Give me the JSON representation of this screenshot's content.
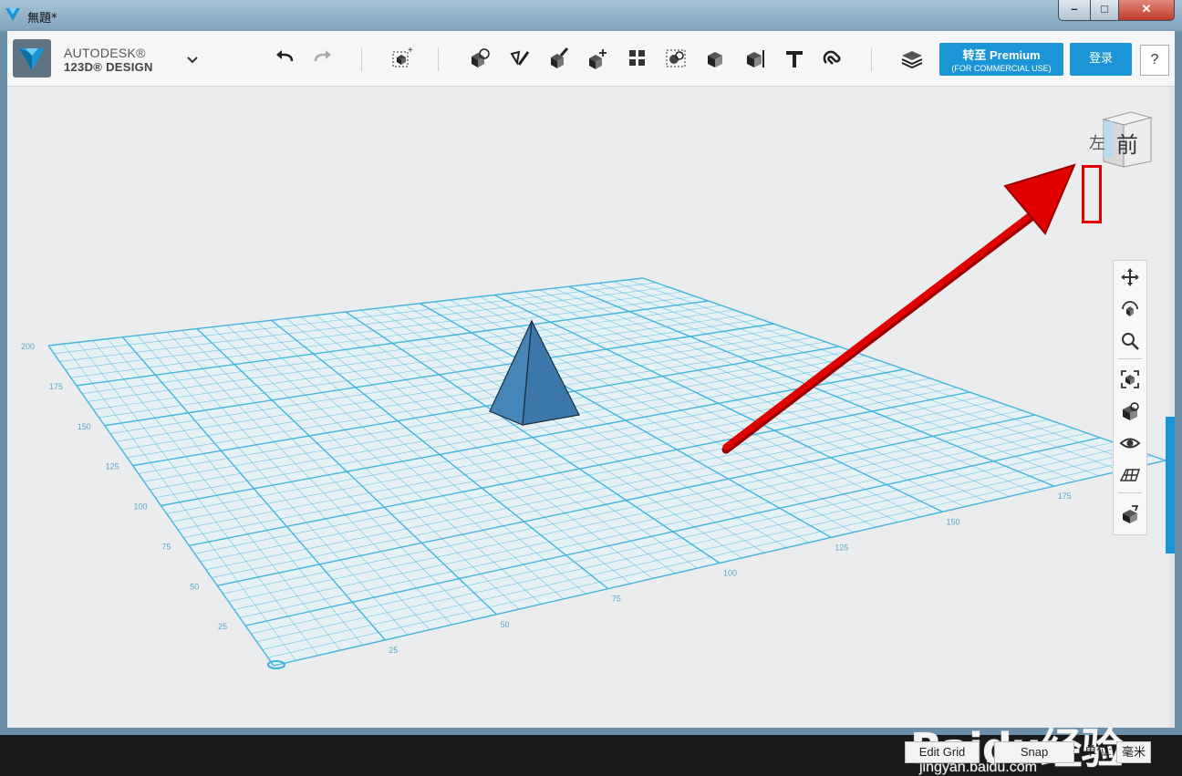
{
  "window": {
    "title": "無題*"
  },
  "window_controls": {
    "minimize": "–",
    "maximize": "□",
    "close": "✕"
  },
  "brand": {
    "line1": "AUTODESK®",
    "line2": "123D® DESIGN"
  },
  "toolbar": {
    "icons": [
      "undo-icon",
      "redo-icon",
      "new-object-icon",
      "primitives-icon",
      "sketch-icon",
      "construct-icon",
      "modify-icon",
      "pattern-icon",
      "grouping-icon",
      "combine-icon",
      "measure-icon",
      "text-icon",
      "snap-icon",
      "materials-icon"
    ]
  },
  "premium": {
    "label": "转至 Premium",
    "sublabel": "(FOR COMMERCIAL USE)"
  },
  "login": {
    "label": "登录"
  },
  "help": {
    "label": "?"
  },
  "viewcube": {
    "front_label": "前",
    "left_label": "左"
  },
  "grid": {
    "left_ticks": [
      "200",
      "175",
      "150",
      "125",
      "100",
      "75",
      "50",
      "25"
    ],
    "front_ticks": [
      "25",
      "50",
      "75",
      "100",
      "125",
      "150",
      "175"
    ]
  },
  "status": {
    "edit_grid": "Edit Grid",
    "snap": "Snap",
    "units_label": "单位:",
    "units_value": "毫米"
  },
  "watermark": {
    "main": "Baidu经验",
    "sub": "jingyan.baidu.com"
  },
  "colors": {
    "accent": "#1b95d6",
    "grid": "#3bb2dd",
    "pyramid": "#3e7fb1",
    "annotation": "#e00000"
  }
}
